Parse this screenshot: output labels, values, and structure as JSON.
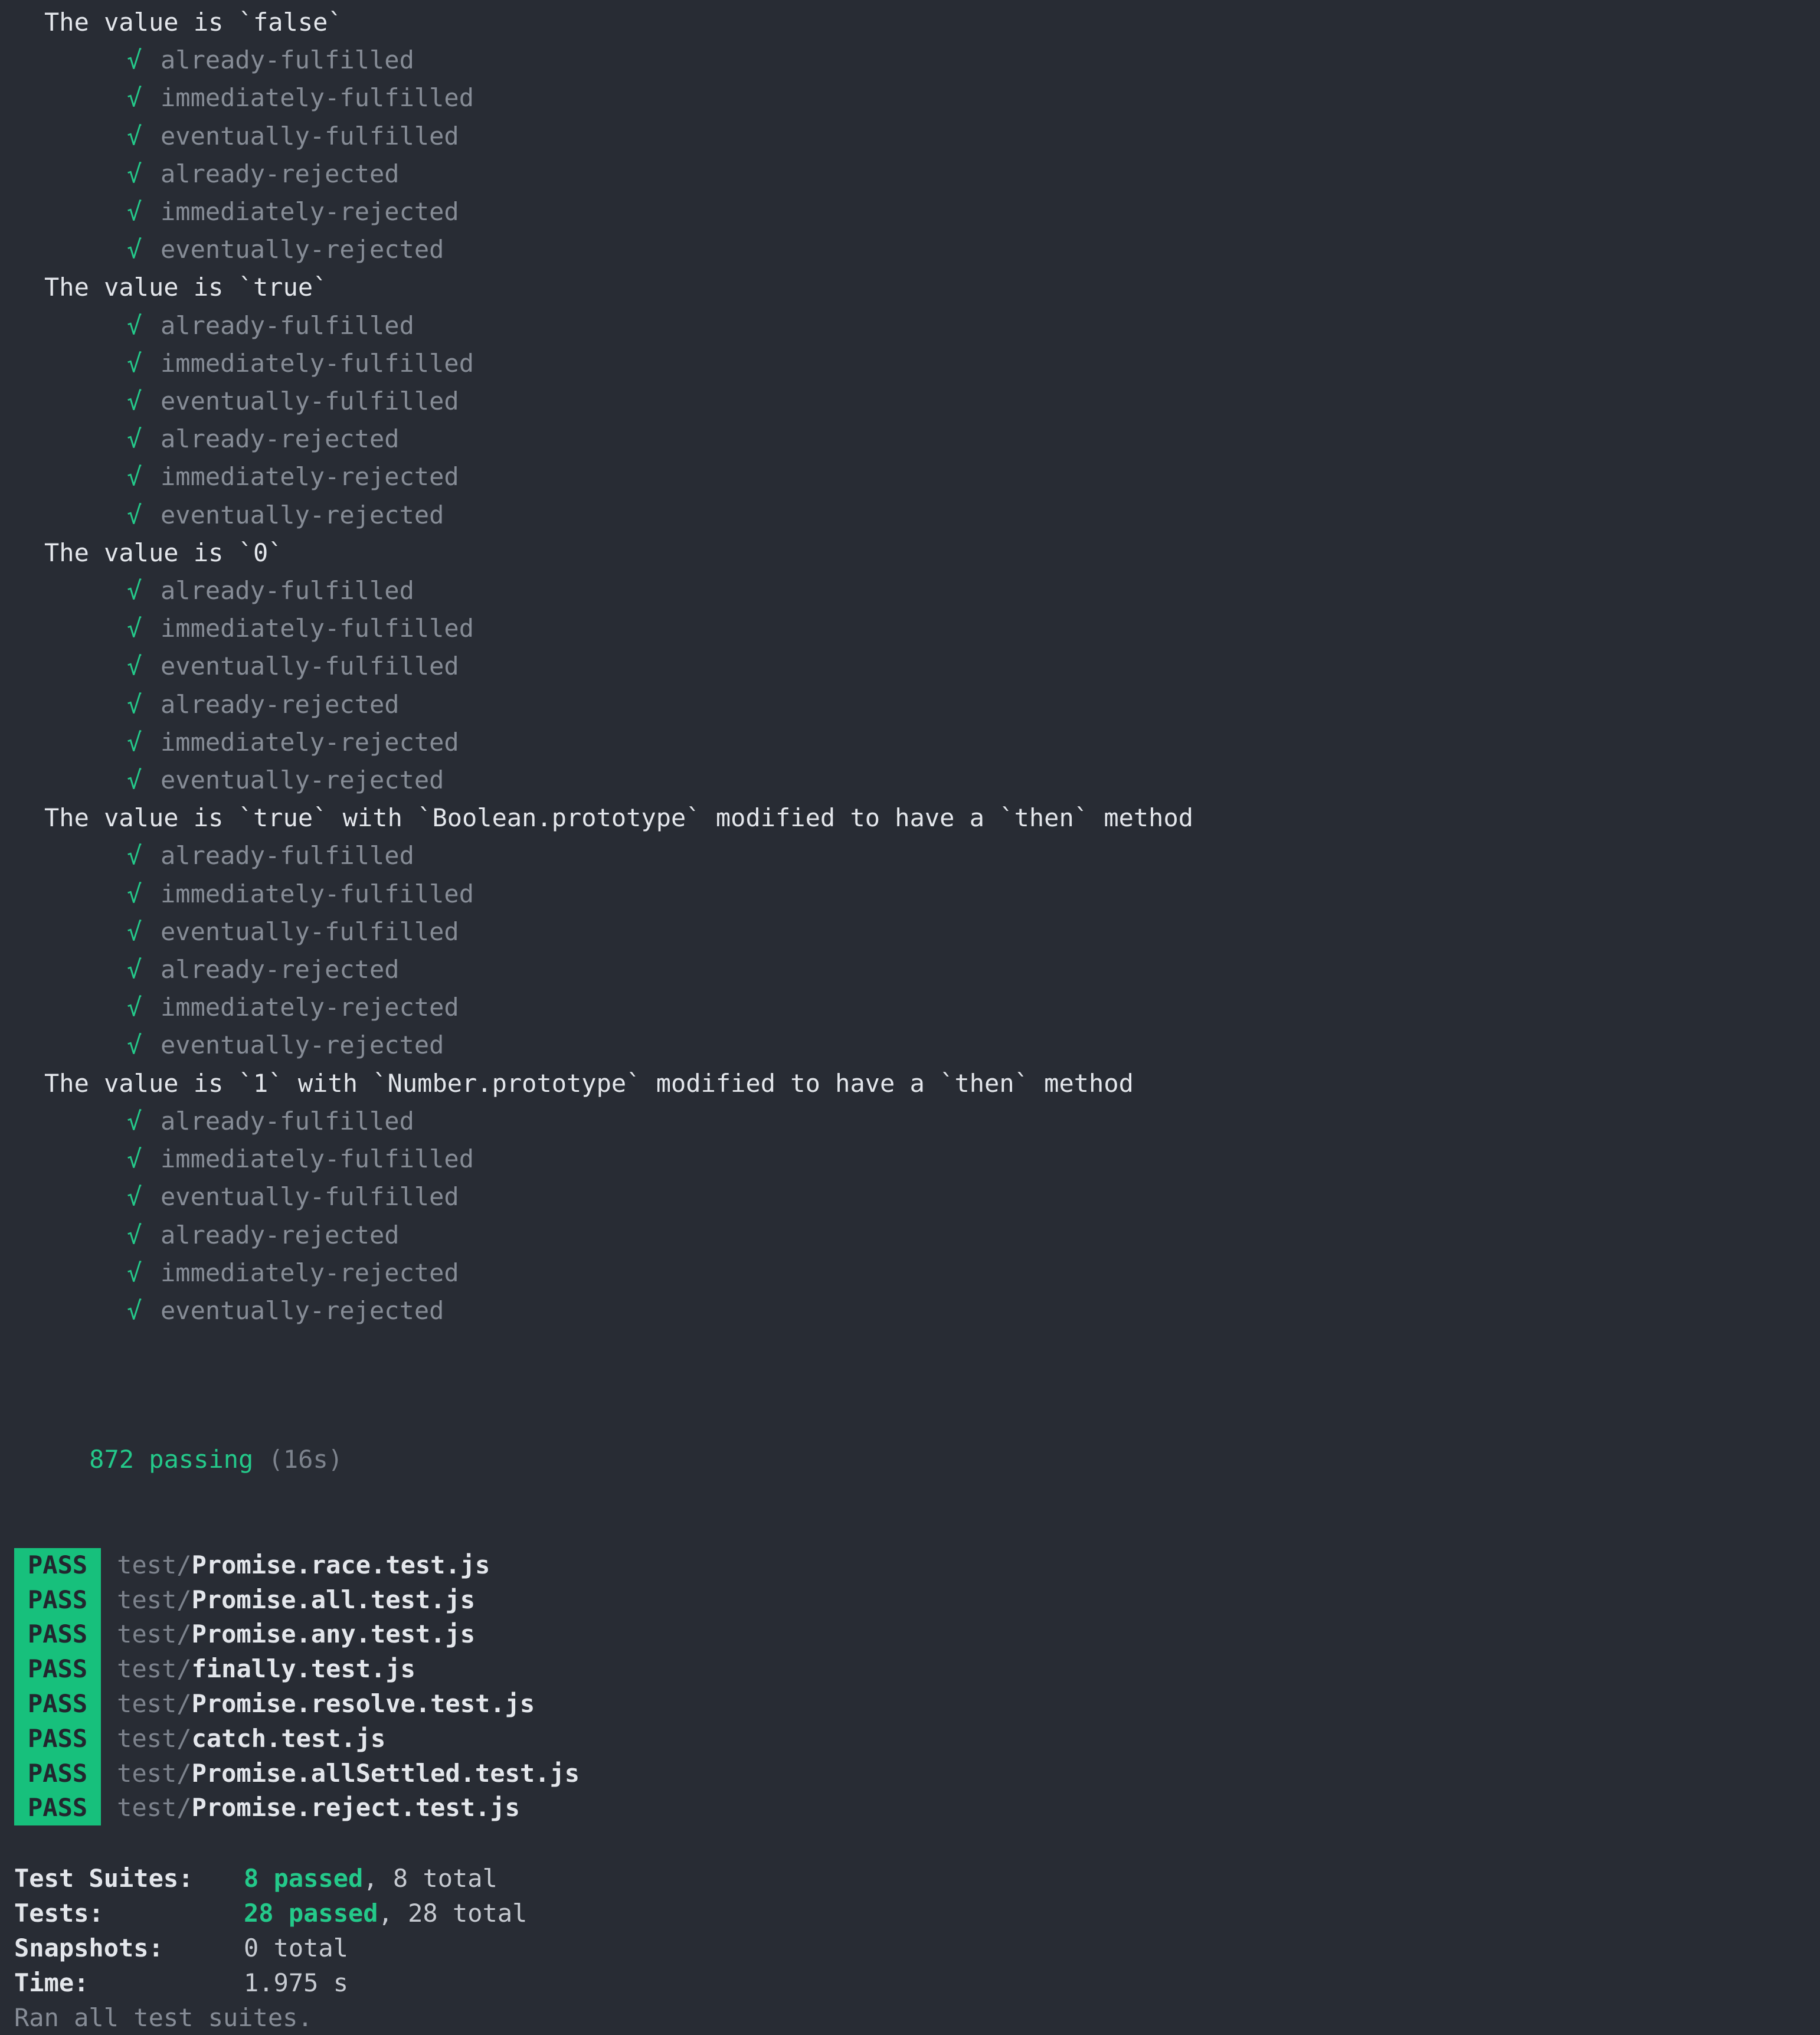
{
  "terminal": {
    "background": "#282c34",
    "check_glyph": "√",
    "colors": {
      "pass_green": "#24c98a",
      "badge_green": "#17c07c",
      "badge_text": "#22262e",
      "dim_gray": "#868c96",
      "bright": "#e3e6eb"
    }
  },
  "mocha": {
    "suites": [
      {
        "title": "The value is `false`",
        "tests": [
          "already-fulfilled",
          "immediately-fulfilled",
          "eventually-fulfilled",
          "already-rejected",
          "immediately-rejected",
          "eventually-rejected"
        ]
      },
      {
        "title": "The value is `true`",
        "tests": [
          "already-fulfilled",
          "immediately-fulfilled",
          "eventually-fulfilled",
          "already-rejected",
          "immediately-rejected",
          "eventually-rejected"
        ]
      },
      {
        "title": "The value is `0`",
        "tests": [
          "already-fulfilled",
          "immediately-fulfilled",
          "eventually-fulfilled",
          "already-rejected",
          "immediately-rejected",
          "eventually-rejected"
        ]
      },
      {
        "title": "The value is `true` with `Boolean.prototype` modified to have a `then` method",
        "tests": [
          "already-fulfilled",
          "immediately-fulfilled",
          "eventually-fulfilled",
          "already-rejected",
          "immediately-rejected",
          "eventually-rejected"
        ]
      },
      {
        "title": "The value is `1` with `Number.prototype` modified to have a `then` method",
        "tests": [
          "already-fulfilled",
          "immediately-fulfilled",
          "eventually-fulfilled",
          "already-rejected",
          "immediately-rejected",
          "eventually-rejected"
        ]
      }
    ],
    "summary": {
      "count_label": "872 passing",
      "duration": "(16s)"
    }
  },
  "jest": {
    "suites": [
      {
        "status": "PASS",
        "dir": "test/",
        "file": "Promise.race.test.js"
      },
      {
        "status": "PASS",
        "dir": "test/",
        "file": "Promise.all.test.js"
      },
      {
        "status": "PASS",
        "dir": "test/",
        "file": "Promise.any.test.js"
      },
      {
        "status": "PASS",
        "dir": "test/",
        "file": "finally.test.js"
      },
      {
        "status": "PASS",
        "dir": "test/",
        "file": "Promise.resolve.test.js"
      },
      {
        "status": "PASS",
        "dir": "test/",
        "file": "catch.test.js"
      },
      {
        "status": "PASS",
        "dir": "test/",
        "file": "Promise.allSettled.test.js"
      },
      {
        "status": "PASS",
        "dir": "test/",
        "file": "Promise.reject.test.js"
      }
    ],
    "totals": [
      {
        "label": "Test Suites:",
        "passed": "8 passed",
        "rest": ", 8 total"
      },
      {
        "label": "Tests:",
        "passed": "28 passed",
        "rest": ", 28 total"
      },
      {
        "label": "Snapshots:",
        "passed": "",
        "rest": "0 total"
      },
      {
        "label": "Time:",
        "passed": "",
        "rest": "1.975 s"
      }
    ],
    "ran_all": "Ran all test suites."
  }
}
